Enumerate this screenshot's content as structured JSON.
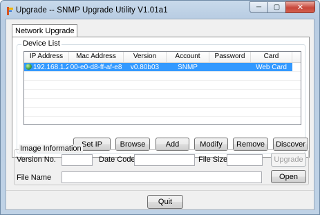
{
  "window": {
    "title": "Upgrade -- SNMP Upgrade Utility V1.01a1",
    "controls": {
      "minimize": "─",
      "maximize": "▢",
      "close": "✕"
    }
  },
  "tabs": [
    {
      "label": "Network Upgrade",
      "active": true
    }
  ],
  "device_list": {
    "group_label": "Device List",
    "columns": [
      "IP Address",
      "Mac Address",
      "Version",
      "Account",
      "Password",
      "Card"
    ],
    "rows": [
      {
        "ip": "192.168.1.2",
        "mac": "00-e0-d8-ff-af-e8",
        "version": "v0.80b03",
        "account": "SNMP",
        "password": "",
        "card": "Web Card",
        "selected": true
      }
    ]
  },
  "buttons": {
    "set_ip": "Set IP",
    "browse": "Browse",
    "add": "Add",
    "modify": "Modify",
    "remove": "Remove",
    "discover": "Discover",
    "upgrade": "Upgrade",
    "open": "Open",
    "quit": "Quit"
  },
  "image_info": {
    "group_label": "Image Information",
    "version_label": "Version No.",
    "version_value": "",
    "date_label": "Date Code",
    "date_value": "",
    "size_label": "File Size",
    "size_value": "",
    "file_label": "File Name",
    "file_value": ""
  },
  "colors": {
    "selection": "#3399ff",
    "close_button": "#c7463a"
  }
}
